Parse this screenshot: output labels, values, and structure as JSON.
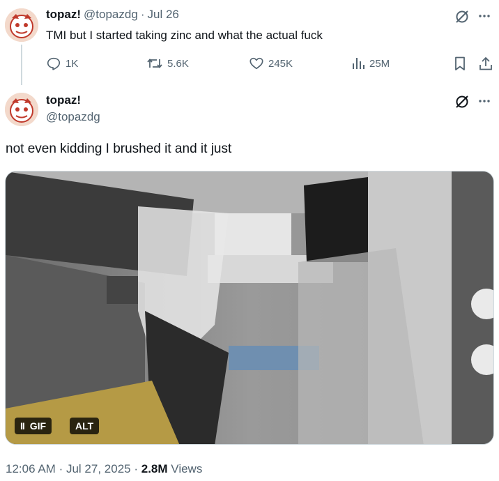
{
  "quoted_post": {
    "display_name": "topaz!",
    "handle": "@topazdg",
    "separator": "·",
    "date": "Jul 26",
    "text": "TMI but I started taking zinc and what the actual fuck",
    "actions": {
      "replies": "1K",
      "reposts": "5.6K",
      "likes": "245K",
      "views": "25M"
    },
    "icons": [
      "grok-icon",
      "more-icon",
      "reply-icon",
      "repost-icon",
      "like-icon",
      "views-icon",
      "bookmark-icon",
      "share-icon"
    ]
  },
  "main_post": {
    "display_name": "topaz!",
    "handle": "@topazdg",
    "text": "not even kidding I brushed it and it just",
    "media": {
      "badges": {
        "pause": "II",
        "gif": "GIF",
        "alt": "ALT"
      }
    },
    "timestamp": {
      "time": "12:06 AM",
      "separator": "·",
      "date": "Jul 27, 2025",
      "separator2": "·",
      "views_count": "2.8M",
      "views_label": "Views"
    }
  },
  "colors": {
    "text": "#0f1419",
    "muted": "#536471",
    "border": "#cfd9de"
  }
}
